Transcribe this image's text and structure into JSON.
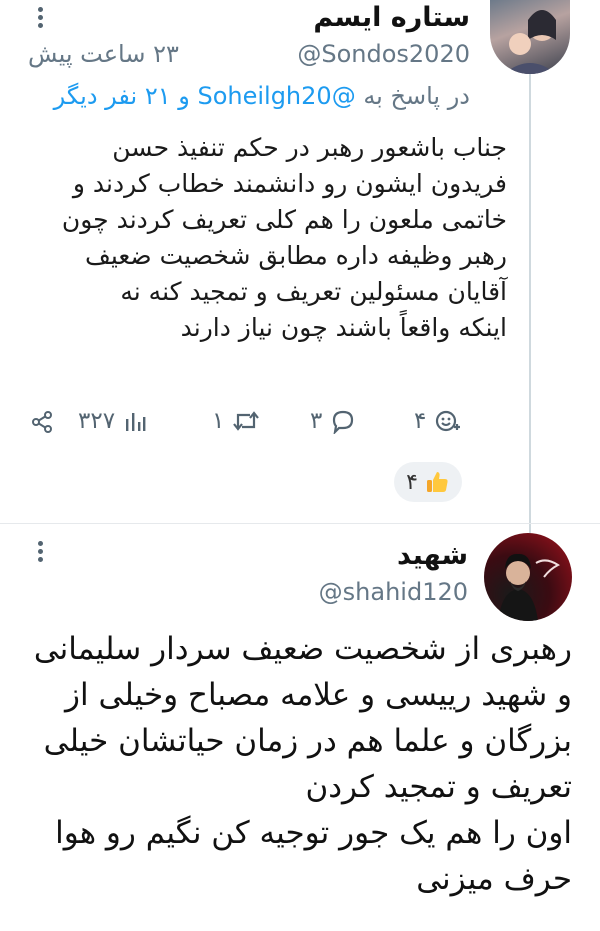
{
  "tweet1": {
    "name": "ستاره ایسم",
    "handle": "@Sondos2020",
    "time": "۲۳ ساعت پیش",
    "reply_prefix": "در پاسخ به ",
    "reply_user": "@Soheilgh20",
    "reply_suffix": " و ۲۱ نفر دیگر",
    "lines": [
      "جناب باشعور رهبر در حکم تنفیذ حسن",
      "فریدون ایشون رو دانشمند خطاب کردند و",
      "خاتمی ملعون را هم کلی تعریف کردند چون",
      "رهبر وظیفه داره مطابق شخصیت ضعیف",
      "آقایان مسئولین تعریف و تمجید کنه نه",
      "اینکه واقعاً باشند چون نیاز دارند"
    ],
    "actions": {
      "reactions": "۴",
      "replies": "۳",
      "retweets": "۱",
      "views": "۳۲۷"
    },
    "reaction_pill_count": "۴"
  },
  "tweet2": {
    "name": "شهید",
    "handle": "@shahid120",
    "lines": [
      "رهبری از شخصیت ضعیف سردار سلیمانی",
      "و شهید رییسی و علامه مصباح وخیلی از",
      "بزرگان و علما هم در زمان حیاتشان خیلی",
      "تعریف و تمجید کردن",
      "اون را هم یک جور توجیه کن نگیم رو هوا",
      "حرف میزنی"
    ]
  },
  "colors": {
    "link": "#1d9bf0",
    "muted": "#657786",
    "thread_line": "#cfd9de"
  },
  "icons": [
    "more-icon",
    "add-reaction-icon",
    "reply-icon",
    "retweet-icon",
    "views-icon",
    "share-icon",
    "thumbs-up-icon"
  ]
}
